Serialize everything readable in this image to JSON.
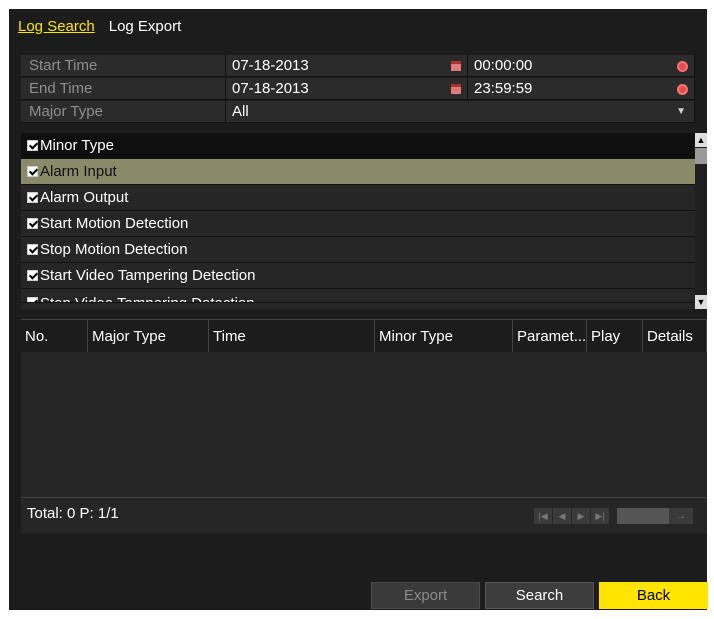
{
  "tabs": [
    {
      "label": "Log Search",
      "active": true
    },
    {
      "label": "Log Export",
      "active": false
    }
  ],
  "filters": {
    "start_time": {
      "label": "Start Time",
      "date": "07-18-2013",
      "time": "00:00:00"
    },
    "end_time": {
      "label": "End Time",
      "date": "07-18-2013",
      "time": "23:59:59"
    },
    "major_type": {
      "label": "Major Type",
      "value": "All"
    }
  },
  "minor_types": {
    "header": "Minor Type",
    "items": [
      "Alarm Input",
      "Alarm Output",
      "Start Motion Detection",
      "Stop Motion Detection",
      "Start Video Tampering Detection",
      "Stop Video Tampering Detection"
    ],
    "selected_index": 0
  },
  "table": {
    "columns": [
      "No.",
      "Major Type",
      "Time",
      "Minor Type",
      "Paramet...",
      "Play",
      "Details"
    ],
    "rows": []
  },
  "footer": {
    "total": "Total: 0  P: 1/1"
  },
  "buttons": {
    "export": "Export",
    "search": "Search",
    "back": "Back"
  },
  "colors": {
    "accent": "#ffe500",
    "panel_bg": "#1c1c1c",
    "selected_row": "#8a8a6a"
  }
}
